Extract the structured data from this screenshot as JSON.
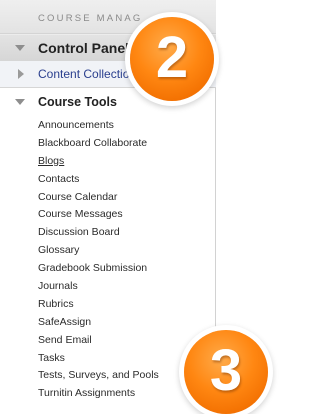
{
  "menu_header": {
    "label": "COURSE MANAG"
  },
  "control_panel": {
    "label": "Control Panel"
  },
  "content_collection": {
    "label": "Content Collection"
  },
  "course_tools": {
    "label": "Course Tools",
    "items": [
      "Announcements",
      "Blackboard Collaborate",
      "Blogs",
      "Contacts",
      "Course Calendar",
      "Course Messages",
      "Discussion Board",
      "Glossary",
      "Gradebook Submission",
      "Journals",
      "Rubrics",
      "SafeAssign",
      "Send Email",
      "Tasks",
      "Tests, Surveys, and Pools",
      "Turnitin Assignments"
    ]
  },
  "step_badges": [
    "2",
    "3"
  ],
  "colors": {
    "accent_orange": "#ff8712",
    "link_blue": "#2a3f8e"
  }
}
